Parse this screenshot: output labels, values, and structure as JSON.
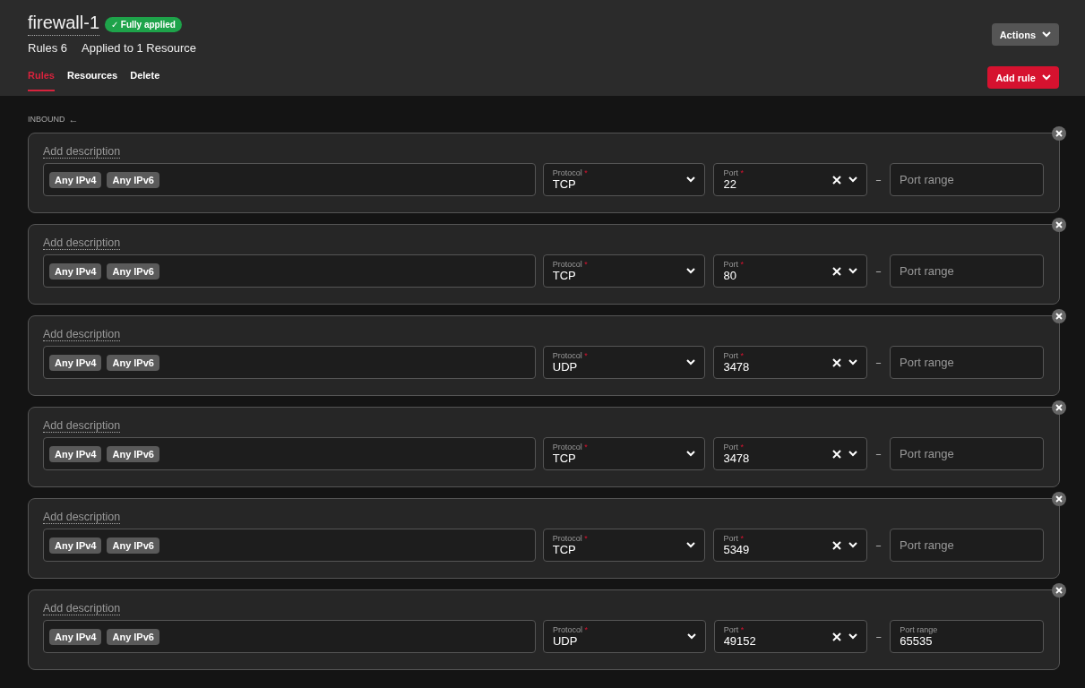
{
  "header": {
    "title": "firewall-1",
    "status_badge": {
      "icon": "✓",
      "label": "Fully applied"
    },
    "stats": [
      "Rules 6",
      "Applied to 1 Resource"
    ],
    "actions_button": "Actions",
    "add_rule_button": "Add rule"
  },
  "tabs": [
    {
      "label": "Rules",
      "selected": true
    },
    {
      "label": "Resources",
      "selected": false
    },
    {
      "label": "Delete",
      "selected": false
    }
  ],
  "section": {
    "title": "INBOUND",
    "arrow": "←"
  },
  "rules": [
    {
      "description_placeholder": "Add description",
      "sources": [
        "Any IPv4",
        "Any IPv6"
      ],
      "protocol": {
        "label": "Protocol",
        "required_mark": "*",
        "value": "TCP"
      },
      "port": {
        "label": "Port",
        "required_mark": "*",
        "value": "22"
      },
      "dash": "–",
      "port_range": {
        "placeholder": "Port range"
      }
    },
    {
      "description_placeholder": "Add description",
      "sources": [
        "Any IPv4",
        "Any IPv6"
      ],
      "protocol": {
        "label": "Protocol",
        "required_mark": "*",
        "value": "TCP"
      },
      "port": {
        "label": "Port",
        "required_mark": "*",
        "value": "80"
      },
      "dash": "–",
      "port_range": {
        "placeholder": "Port range"
      }
    },
    {
      "description_placeholder": "Add description",
      "sources": [
        "Any IPv4",
        "Any IPv6"
      ],
      "protocol": {
        "label": "Protocol",
        "required_mark": "*",
        "value": "UDP"
      },
      "port": {
        "label": "Port",
        "required_mark": "*",
        "value": "3478"
      },
      "dash": "–",
      "port_range": {
        "placeholder": "Port range"
      }
    },
    {
      "description_placeholder": "Add description",
      "sources": [
        "Any IPv4",
        "Any IPv6"
      ],
      "protocol": {
        "label": "Protocol",
        "required_mark": "*",
        "value": "TCP"
      },
      "port": {
        "label": "Port",
        "required_mark": "*",
        "value": "3478"
      },
      "dash": "–",
      "port_range": {
        "placeholder": "Port range"
      }
    },
    {
      "description_placeholder": "Add description",
      "sources": [
        "Any IPv4",
        "Any IPv6"
      ],
      "protocol": {
        "label": "Protocol",
        "required_mark": "*",
        "value": "TCP"
      },
      "port": {
        "label": "Port",
        "required_mark": "*",
        "value": "5349"
      },
      "dash": "–",
      "port_range": {
        "placeholder": "Port range"
      }
    },
    {
      "description_placeholder": "Add description",
      "sources": [
        "Any IPv4",
        "Any IPv6"
      ],
      "protocol": {
        "label": "Protocol",
        "required_mark": "*",
        "value": "UDP"
      },
      "port": {
        "label": "Port",
        "required_mark": "*",
        "value": "49152"
      },
      "dash": "–",
      "port_range": {
        "label": "Port range",
        "value": "65535"
      }
    }
  ]
}
